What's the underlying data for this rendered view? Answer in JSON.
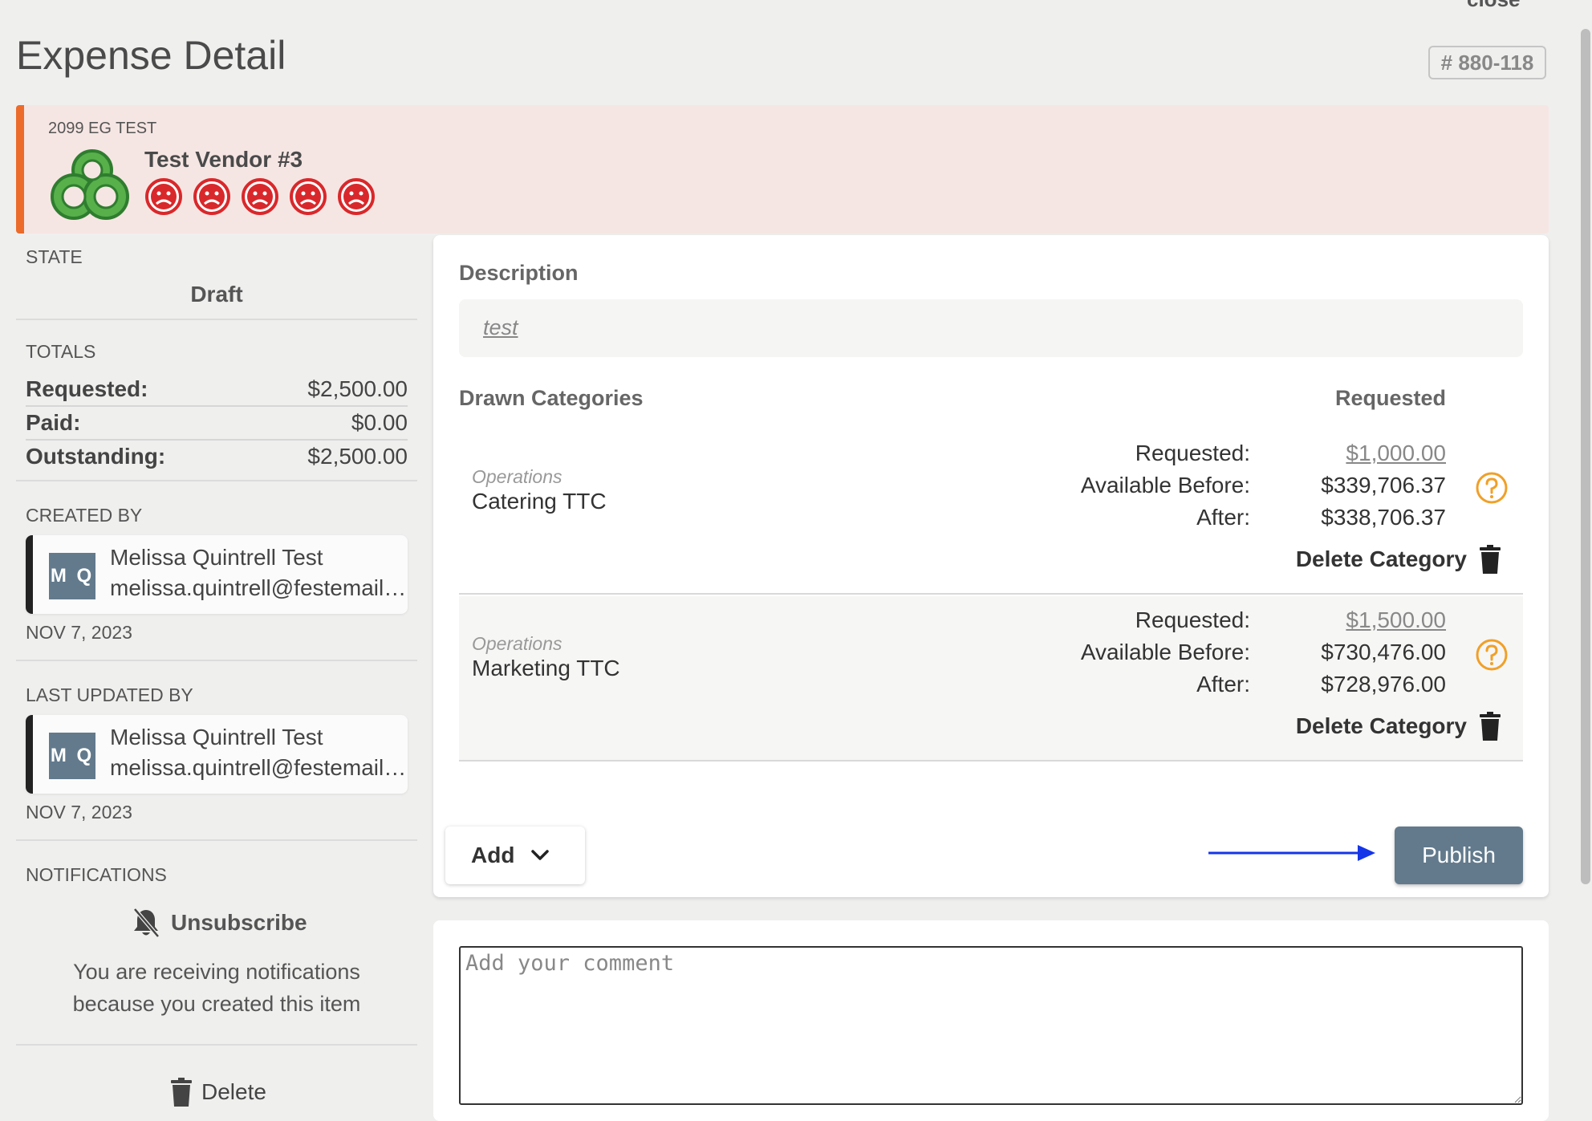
{
  "header": {
    "close_label": "close",
    "title": "Expense Detail",
    "ref_number": "# 880-118"
  },
  "vendor": {
    "event_name": "2099 EG TEST",
    "name": "Test Vendor #3",
    "rating": 0,
    "rating_max": 5,
    "logo_color": "#3a9a3a",
    "face_color": "#d9282b"
  },
  "sidebar": {
    "state_label": "STATE",
    "state_value": "Draft",
    "totals_label": "TOTALS",
    "totals": [
      {
        "label": "Requested:",
        "value": "$2,500.00"
      },
      {
        "label": "Paid:",
        "value": "$0.00"
      },
      {
        "label": "Outstanding:",
        "value": "$2,500.00"
      }
    ],
    "created_by": {
      "label": "CREATED BY",
      "initials": "M Q",
      "name": "Melissa Quintrell Test",
      "email": "melissa.quintrell@festemailtest.com",
      "date": "NOV 7, 2023"
    },
    "last_updated_by": {
      "label": "LAST UPDATED BY",
      "initials": "M Q",
      "name": "Melissa Quintrell Test",
      "email": "melissa.quintrell@festemailtest.com",
      "date": "NOV 7, 2023"
    },
    "notifications": {
      "label": "NOTIFICATIONS",
      "unsubscribe_label": "Unsubscribe",
      "message_line1": "You are receiving notifications",
      "message_line2": "because you created this item"
    },
    "delete_label": "Delete"
  },
  "main": {
    "description_label": "Description",
    "description_value": "test",
    "drawn_categories_label": "Drawn Categories",
    "requested_header": "Requested",
    "requested_label": "Requested:",
    "available_before_label": "Available Before:",
    "after_label": "After:",
    "delete_category_label": "Delete Category",
    "categories": [
      {
        "group": "Operations",
        "name": "Catering TTC",
        "requested": "$1,000.00",
        "available_before": "$339,706.37",
        "after": "$338,706.37"
      },
      {
        "group": "Operations",
        "name": "Marketing TTC",
        "requested": "$1,500.00",
        "available_before": "$730,476.00",
        "after": "$728,976.00"
      }
    ],
    "add_label": "Add",
    "publish_label": "Publish"
  },
  "comment": {
    "placeholder": "Add your comment"
  },
  "colors": {
    "accent_orange": "#ec6b2a",
    "banner_bg": "#f6e6e3",
    "publish_bg": "#627a8c",
    "help_icon": "#f0a028",
    "arrow": "#1535e8"
  }
}
